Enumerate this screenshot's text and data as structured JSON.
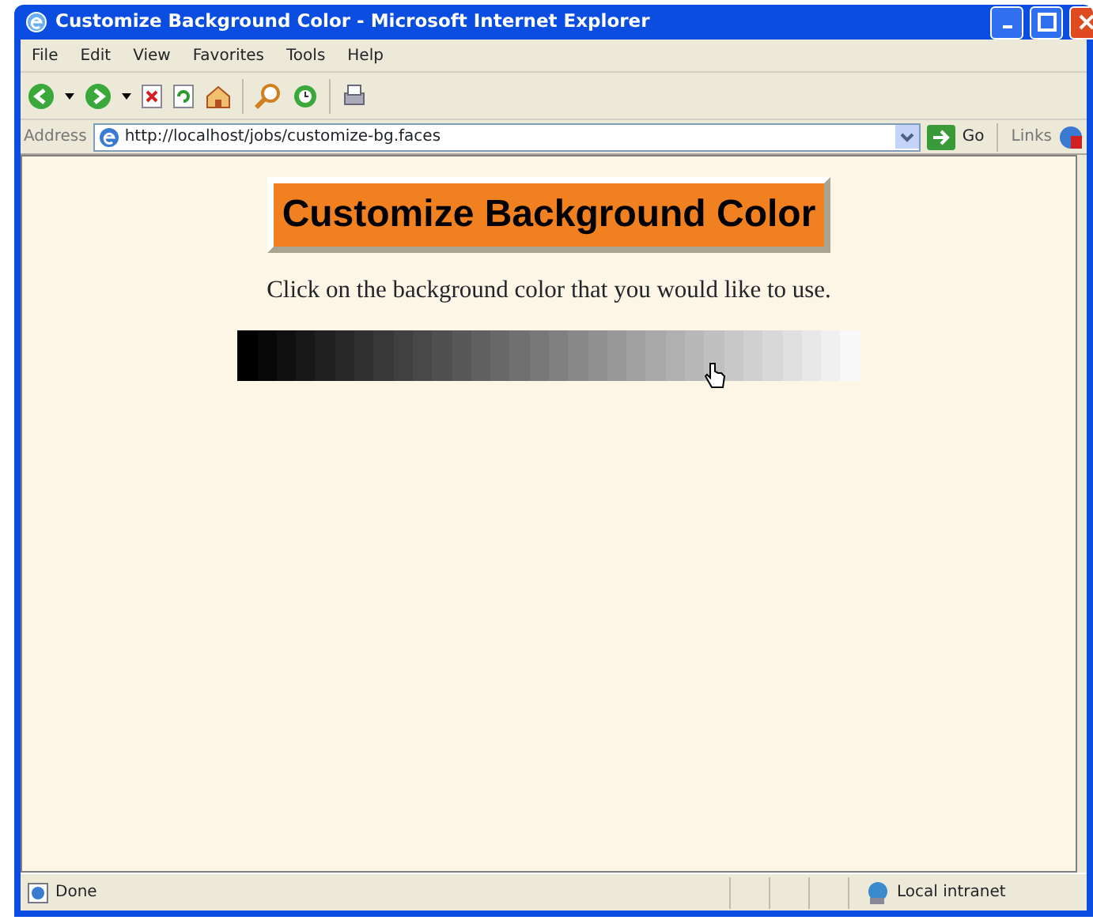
{
  "window": {
    "title": "Customize Background Color - Microsoft Internet Explorer"
  },
  "menu": [
    "File",
    "Edit",
    "View",
    "Favorites",
    "Tools",
    "Help"
  ],
  "address_bar": {
    "label": "Address",
    "url": "http://localhost/jobs/customize-bg.faces",
    "go": "Go",
    "links": "Links"
  },
  "page": {
    "heading": "Customize Background Color",
    "instruction": "Click on the background color that you would like to use.",
    "swatches": [
      {
        "color": "#000000"
      },
      {
        "color": "#080808"
      },
      {
        "color": "#101010"
      },
      {
        "color": "#181818"
      },
      {
        "color": "#202020"
      },
      {
        "color": "#282828"
      },
      {
        "color": "#303030"
      },
      {
        "color": "#383838"
      },
      {
        "color": "#404040"
      },
      {
        "color": "#484848"
      },
      {
        "color": "#505050"
      },
      {
        "color": "#585858"
      },
      {
        "color": "#606060"
      },
      {
        "color": "#686868"
      },
      {
        "color": "#707070"
      },
      {
        "color": "#787878"
      },
      {
        "color": "#808080"
      },
      {
        "color": "#888888"
      },
      {
        "color": "#909090"
      },
      {
        "color": "#989898"
      },
      {
        "color": "#a0a0a0"
      },
      {
        "color": "#a8a8a8"
      },
      {
        "color": "#b0b0b0"
      },
      {
        "color": "#b8b8b8"
      },
      {
        "color": "#c0c0c0"
      },
      {
        "color": "#c8c8c8"
      },
      {
        "color": "#d0d0d0"
      },
      {
        "color": "#d8d8d8"
      },
      {
        "color": "#e0e0e0"
      },
      {
        "color": "#e8e8e8"
      },
      {
        "color": "#f0f0f0"
      },
      {
        "color": "#f8f8f8"
      }
    ]
  },
  "status_bar": {
    "status": "Done",
    "zone": "Local intranet"
  }
}
